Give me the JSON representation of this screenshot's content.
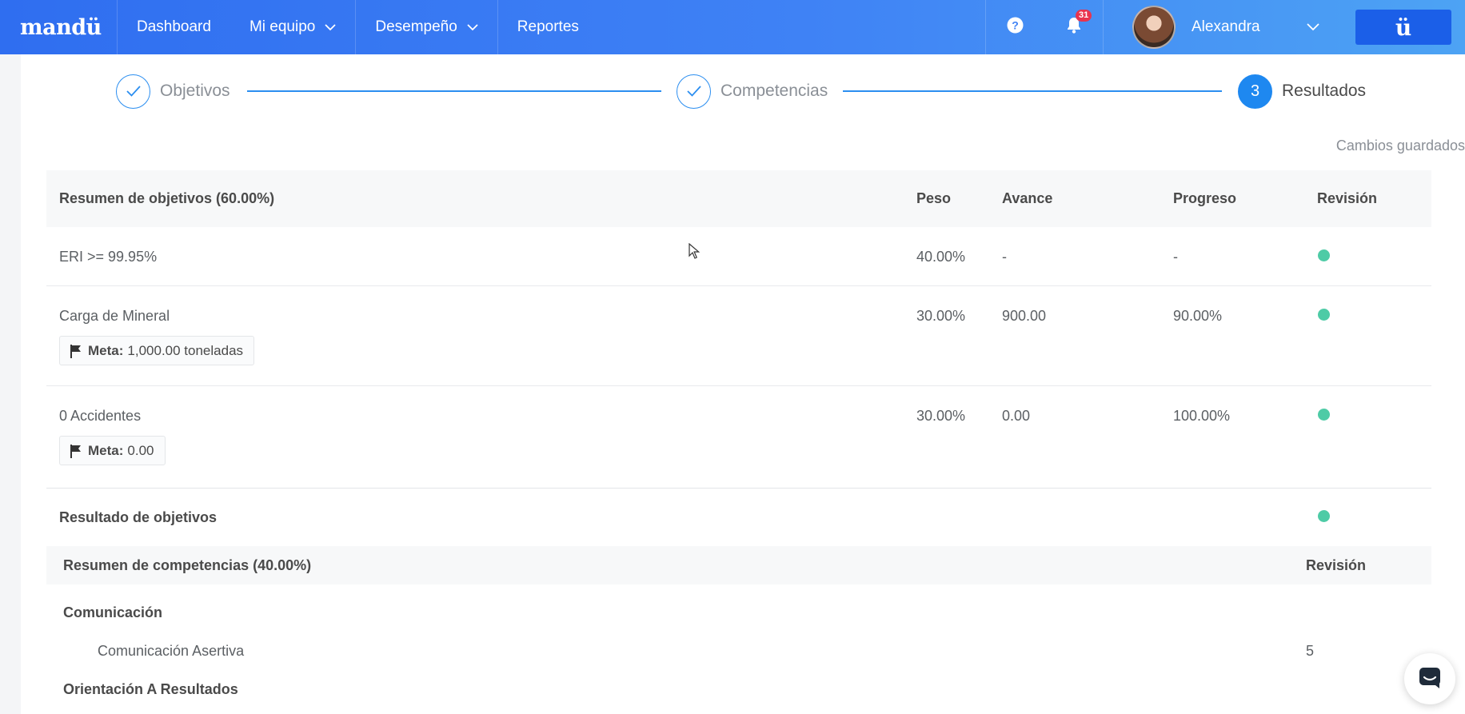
{
  "nav": {
    "logo": "mandü",
    "items": [
      {
        "label": "Dashboard",
        "has_dropdown": false
      },
      {
        "label": "Mi equipo",
        "has_dropdown": true
      },
      {
        "label": "Desempeño",
        "has_dropdown": true
      },
      {
        "label": "Reportes",
        "has_dropdown": false
      }
    ],
    "notifications_count": "31",
    "user_name": "Alexandra",
    "brand_button": "ü",
    "colors": {
      "gradient_start": "#2f6ef0",
      "gradient_end": "#4da3f4",
      "brand_button": "#1b5fe8"
    }
  },
  "stepper": {
    "steps": [
      {
        "label": "Objetivos",
        "state": "done",
        "marker": "check-icon"
      },
      {
        "label": "Competencias",
        "state": "done",
        "marker": "check-icon"
      },
      {
        "label": "Resultados",
        "state": "active",
        "marker": "3"
      }
    ],
    "accent": "#1e88f0"
  },
  "status": "Cambios guardados",
  "objectives": {
    "header": {
      "name": "Resumen de objetivos (60.00%)",
      "peso": "Peso",
      "avance": "Avance",
      "progreso": "Progreso",
      "revision": "Revisión"
    },
    "rows": [
      {
        "name": "ERI >= 99.95%",
        "peso": "40.00%",
        "avance": "-",
        "progreso": "-",
        "revision_status": "green",
        "meta": null
      },
      {
        "name": "Carga de Mineral",
        "peso": "30.00%",
        "avance": "900.00",
        "progreso": "90.00%",
        "revision_status": "green",
        "meta": {
          "label": "Meta:",
          "value": "1,000.00 toneladas"
        }
      },
      {
        "name": "0 Accidentes",
        "peso": "30.00%",
        "avance": "0.00",
        "progreso": "100.00%",
        "revision_status": "green",
        "meta": {
          "label": "Meta:",
          "value": "0.00"
        }
      }
    ],
    "result_label": "Resultado de objetivos",
    "result_status": "green",
    "status_color": "#4ecba6"
  },
  "competencies": {
    "header": {
      "name": "Resumen de competencias (40.00%)",
      "revision": "Revisión"
    },
    "groups": [
      {
        "name": "Comunicación",
        "items": [
          {
            "name": "Comunicación Asertiva",
            "revision": "5"
          }
        ]
      },
      {
        "name": "Orientación A Resultados",
        "items": []
      }
    ]
  }
}
